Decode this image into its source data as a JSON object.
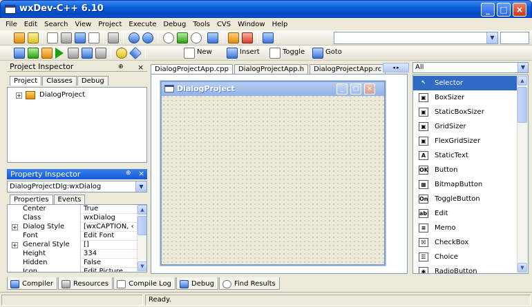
{
  "window": {
    "title": "wxDev-C++ 6.10"
  },
  "menu": [
    "File",
    "Edit",
    "Search",
    "View",
    "Project",
    "Execute",
    "Debug",
    "Tools",
    "CVS",
    "Window",
    "Help"
  ],
  "toolbar2": {
    "new_label": "New",
    "insert_label": "Insert",
    "toggle_label": "Toggle",
    "goto_label": "Goto"
  },
  "project_inspector": {
    "title": "Project Inspector",
    "pin": "⊕",
    "close": "×",
    "tabs": [
      "Project",
      "Classes",
      "Debug"
    ],
    "tree_root": "DialogProject"
  },
  "property_inspector": {
    "title": "Property Inspector",
    "selected_object": "DialogProjectDlg:wxDialog",
    "tabs": [
      "Properties",
      "Events"
    ],
    "rows": [
      {
        "name": "Center",
        "value": "True",
        "expander": ""
      },
      {
        "name": "Class",
        "value": "wxDialog",
        "expander": ""
      },
      {
        "name": "Dialog Style",
        "value": "[wxCAPTION, ‹",
        "expander": "+"
      },
      {
        "name": "Font",
        "value": "Edit Font",
        "expander": ""
      },
      {
        "name": "General Style",
        "value": "[]",
        "expander": "+"
      },
      {
        "name": "Height",
        "value": "334",
        "expander": ""
      },
      {
        "name": "Hidden",
        "value": "False",
        "expander": ""
      },
      {
        "name": "Icon",
        "value": "Edit Picture",
        "expander": ""
      }
    ]
  },
  "editor": {
    "tabs": [
      "DialogProjectApp.cpp",
      "DialogProjectApp.h",
      "DialogProjectApp.rc"
    ],
    "active_tab": 0,
    "nav_label": "◂ ▸",
    "form_title": "DialogProject"
  },
  "palette": {
    "filter": "All",
    "items": [
      {
        "label": "Selector",
        "glyph": "↖",
        "selected": true
      },
      {
        "label": "BoxSizer",
        "glyph": "▣"
      },
      {
        "label": "StaticBoxSizer",
        "glyph": "▣"
      },
      {
        "label": "GridSizer",
        "glyph": "▣"
      },
      {
        "label": "FlexGridSizer",
        "glyph": "▣"
      },
      {
        "label": "StaticText",
        "glyph": "A"
      },
      {
        "label": "Button",
        "glyph": "OK"
      },
      {
        "label": "BitmapButton",
        "glyph": "▦"
      },
      {
        "label": "ToggleButton",
        "glyph": "On"
      },
      {
        "label": "Edit",
        "glyph": "ab|"
      },
      {
        "label": "Memo",
        "glyph": "≡"
      },
      {
        "label": "CheckBox",
        "glyph": "☒"
      },
      {
        "label": "Choice",
        "glyph": "☰"
      },
      {
        "label": "RadioButton",
        "glyph": "◉"
      }
    ]
  },
  "bottom_tabs": [
    "Compiler",
    "Resources",
    "Compile Log",
    "Debug",
    "Find Results"
  ],
  "status": {
    "left": "",
    "middle": "Ready."
  },
  "colors": {
    "titlebar": "#0a5fd8",
    "selection": "#316ac5",
    "face": "#ece9d8"
  }
}
